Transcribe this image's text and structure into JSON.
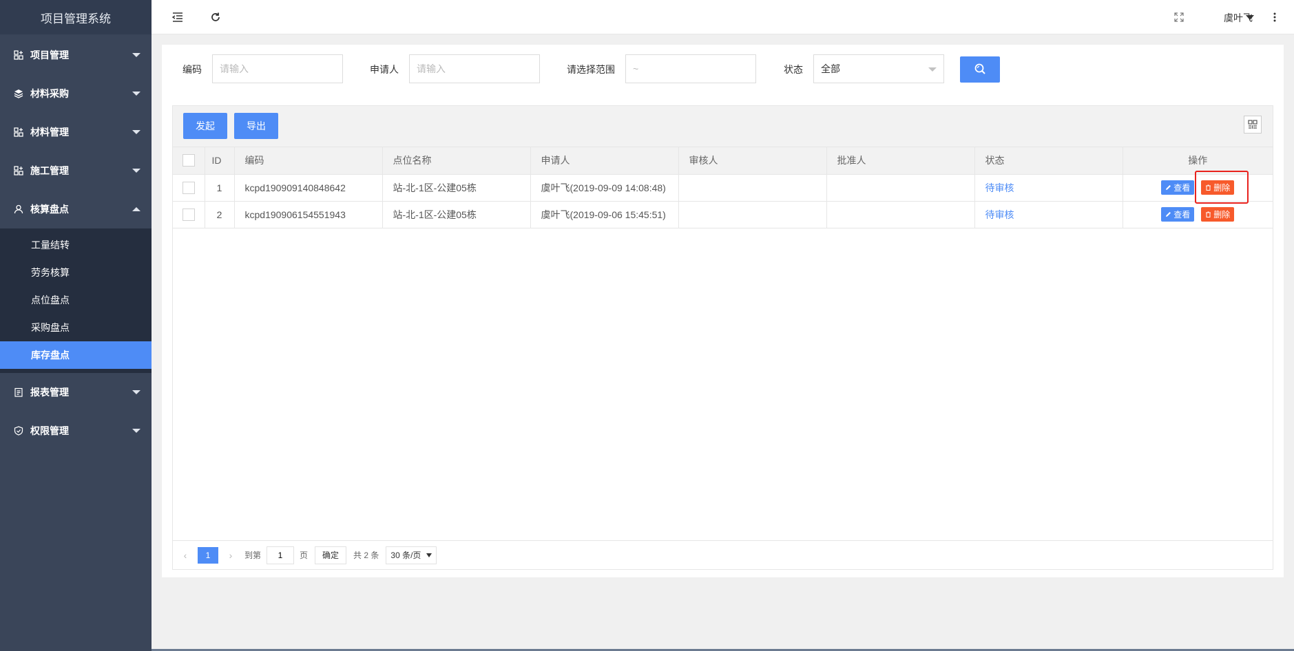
{
  "app": {
    "title": "项目管理系统"
  },
  "sidebar": {
    "items": [
      {
        "label": "项目管理",
        "icon": "grid-plus-icon",
        "expanded": false
      },
      {
        "label": "材料采购",
        "icon": "layers-icon",
        "expanded": false
      },
      {
        "label": "材料管理",
        "icon": "grid-plus-icon",
        "expanded": false
      },
      {
        "label": "施工管理",
        "icon": "grid-plus-icon",
        "expanded": false
      },
      {
        "label": "核算盘点",
        "icon": "user-icon",
        "expanded": true
      },
      {
        "label": "报表管理",
        "icon": "report-icon",
        "expanded": false
      },
      {
        "label": "权限管理",
        "icon": "shield-icon",
        "expanded": false
      }
    ],
    "submenu": [
      "工量结转",
      "劳务核算",
      "点位盘点",
      "采购盘点",
      "库存盘点"
    ],
    "active_sub": "库存盘点"
  },
  "header": {
    "user": "虞叶飞",
    "icons": [
      "menu-fold-icon",
      "refresh-icon",
      "fullscreen-icon",
      "more-vertical-icon"
    ]
  },
  "filters": {
    "code_label": "编码",
    "code_placeholder": "请输入",
    "applicant_label": "申请人",
    "applicant_placeholder": "请输入",
    "range_label": "请选择范围",
    "range_placeholder": "~",
    "status_label": "状态",
    "status_value": "全部"
  },
  "toolbar": {
    "start_label": "发起",
    "export_label": "导出"
  },
  "table": {
    "columns": [
      "ID",
      "编码",
      "点位名称",
      "申请人",
      "审核人",
      "批准人",
      "状态",
      "操作"
    ],
    "rows": [
      {
        "id": "1",
        "code": "kcpd190909140848642",
        "point": "站-北-1区-公建05栋",
        "applicant": "虞叶飞(2019-09-09 14:08:48)",
        "reviewer": "",
        "approver": "",
        "status": "待审核"
      },
      {
        "id": "2",
        "code": "kcpd190906154551943",
        "point": "站-北-1区-公建05栋",
        "applicant": "虞叶飞(2019-09-06 15:45:51)",
        "reviewer": "",
        "approver": "",
        "status": "待审核"
      }
    ],
    "view_label": "查看",
    "delete_label": "删除"
  },
  "pager": {
    "current": "1",
    "goto_label": "到第",
    "goto_value": "1",
    "page_label": "页",
    "ok_label": "确定",
    "total": "共 2 条",
    "page_size": "30 条/页"
  },
  "colors": {
    "primary": "#4e8cf6",
    "danger": "#f75a2b",
    "sidebar": "#3a4559",
    "highlight": "#e8211c"
  }
}
